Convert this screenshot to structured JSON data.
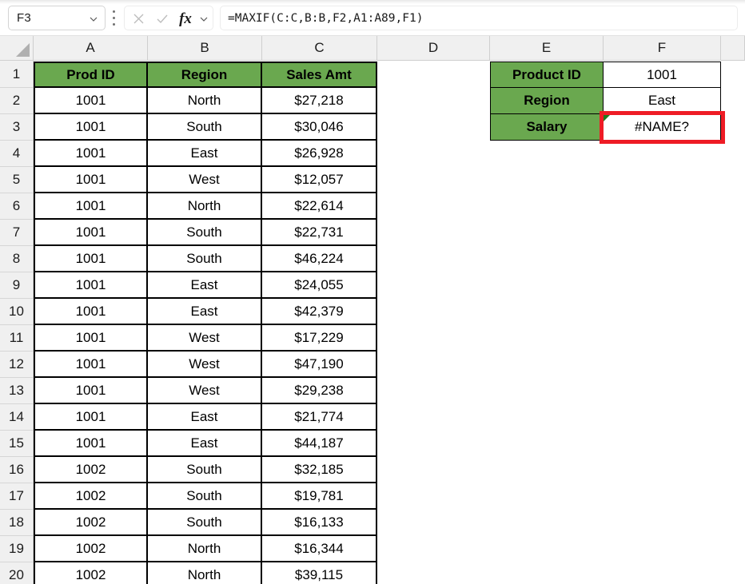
{
  "formula_bar": {
    "name_box_value": "F3",
    "formula_value": "=MAXIF(C:C,B:B,F2,A1:A89,F1)",
    "cancel_icon": "x-icon",
    "enter_icon": "check-icon",
    "function_icon": "fx-icon",
    "function_label": "fx",
    "dropdown_icon": "chevron-down-icon",
    "more_icon": "kebab-menu-icon"
  },
  "grid": {
    "select_all_icon": "select-all-corner-icon",
    "column_headers": [
      "A",
      "B",
      "C",
      "D",
      "E",
      "F"
    ],
    "row_headers": [
      "1",
      "2",
      "3",
      "4",
      "5",
      "6",
      "7",
      "8",
      "9",
      "10",
      "11",
      "12",
      "13",
      "14",
      "15",
      "16",
      "17",
      "18",
      "19",
      "20"
    ],
    "header_fill": "#6aa84f",
    "error_highlight_color": "#ee1c25"
  },
  "data_table": {
    "headers": [
      "Prod ID",
      "Region",
      "Sales Amt"
    ],
    "rows": [
      [
        "1001",
        "North",
        "$27,218"
      ],
      [
        "1001",
        "South",
        "$30,046"
      ],
      [
        "1001",
        "East",
        "$26,928"
      ],
      [
        "1001",
        "West",
        "$12,057"
      ],
      [
        "1001",
        "North",
        "$22,614"
      ],
      [
        "1001",
        "South",
        "$22,731"
      ],
      [
        "1001",
        "South",
        "$46,224"
      ],
      [
        "1001",
        "East",
        "$24,055"
      ],
      [
        "1001",
        "East",
        "$42,379"
      ],
      [
        "1001",
        "West",
        "$17,229"
      ],
      [
        "1001",
        "West",
        "$47,190"
      ],
      [
        "1001",
        "West",
        "$29,238"
      ],
      [
        "1001",
        "East",
        "$21,774"
      ],
      [
        "1001",
        "East",
        "$44,187"
      ],
      [
        "1002",
        "South",
        "$32,185"
      ],
      [
        "1002",
        "South",
        "$19,781"
      ],
      [
        "1002",
        "South",
        "$16,133"
      ],
      [
        "1002",
        "North",
        "$16,344"
      ],
      [
        "1002",
        "North",
        "$39,115"
      ]
    ]
  },
  "lookup_table": {
    "rows": [
      {
        "label": "Product ID",
        "value": "1001"
      },
      {
        "label": "Region",
        "value": "East"
      },
      {
        "label": "Salary",
        "value": "#NAME?"
      }
    ],
    "error_cell_index": 2,
    "error_flag_icon": "error-indicator-triangle-icon"
  }
}
